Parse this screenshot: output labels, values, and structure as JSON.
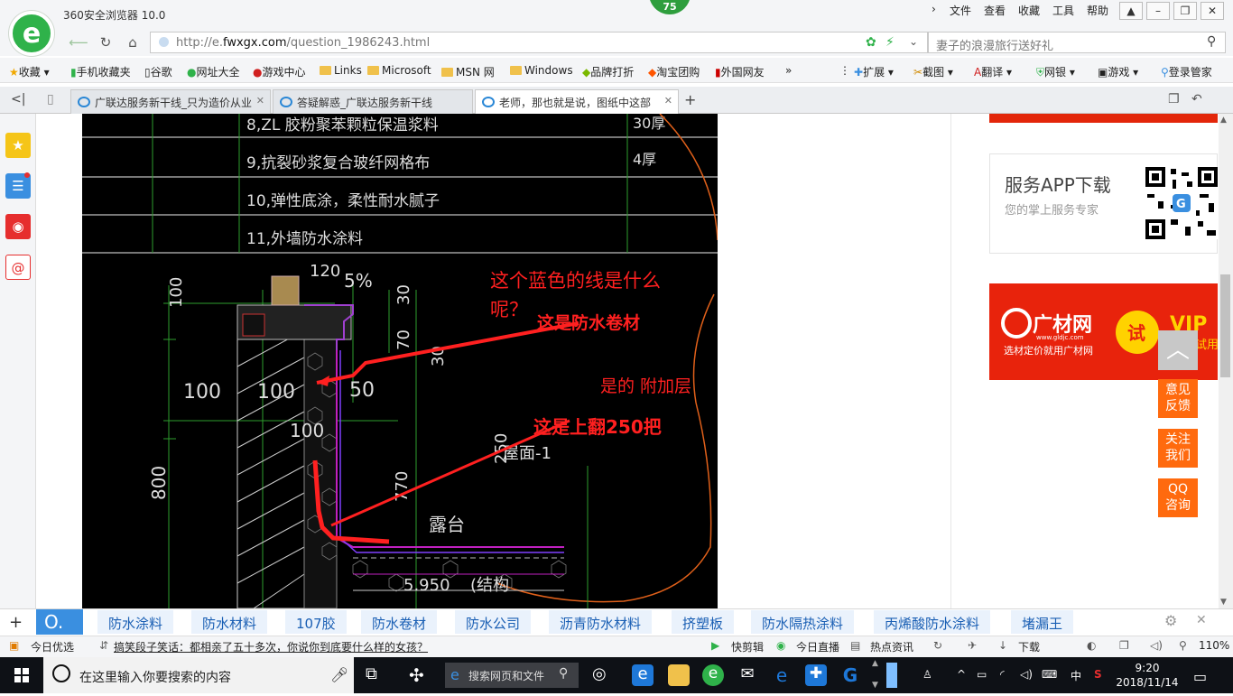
{
  "browser": {
    "title": "360安全浏览器 10.0",
    "badge": "75",
    "menu": [
      "文件",
      "查看",
      "收藏",
      "工具",
      "帮助"
    ]
  },
  "address": {
    "url_prefix": "http://e.",
    "url_domain": "fwxgx.com",
    "url_path": "/question_1986243.html",
    "search_placeholder": "妻子的浪漫旅行送好礼"
  },
  "favorites": [
    "收藏",
    "手机收藏夹",
    "谷歌",
    "网址大全",
    "游戏中心",
    "Links",
    "Microsoft",
    "MSN 网",
    "Windows",
    "品牌打折",
    "淘宝团购",
    "外国网友"
  ],
  "tools": [
    "扩展",
    "截图",
    "翻译",
    "网银",
    "游戏",
    "登录管家"
  ],
  "tabs": [
    {
      "label": "广联达服务新干线_只为造价从业"
    },
    {
      "label": "答疑解惑_广联达服务新干线"
    },
    {
      "label": "老师，那也就是说，图纸中这部"
    }
  ],
  "cad": {
    "table_rows": [
      "8,ZL 胶粉聚苯颗粒保温浆料",
      "9,抗裂砂浆复合玻纤网格布",
      "10,弹性底涂，柔性耐水腻子",
      "11,外墙防水涂料"
    ],
    "table_thick": [
      "30厚",
      "4厚"
    ],
    "dims": [
      "100",
      "100",
      "100",
      "50",
      "100",
      "800",
      "770",
      "70",
      "30",
      "120",
      "5%",
      "30",
      "250"
    ],
    "labels": [
      "屋面-1",
      "露台",
      "5.950",
      "(结构"
    ],
    "annotations": [
      "这个蓝色的线是什么",
      "呢？",
      "这是防水卷材",
      "是的  附加层",
      "这是上翻250把"
    ]
  },
  "right": {
    "app_title": "服务APP下载",
    "app_sub": "您的掌上服务专家",
    "ad_brand": "广材网",
    "ad_url": "www.gldjc.com",
    "ad_slogan": "选材定价就用广材网",
    "ad_try": "试",
    "ad_vip": "VIP",
    "ad_vip2": "试用",
    "btns": [
      "意见反馈",
      "关注我们",
      "QQ咨询"
    ]
  },
  "keywords": [
    "防水涂料",
    "防水材料",
    "107胶",
    "防水卷材",
    "防水公司",
    "沥青防水材料",
    "挤塑板",
    "防水隔热涂料",
    "丙烯酸防水涂料",
    "堵漏王"
  ],
  "status": {
    "left": "今日优选",
    "news": "搞笑段子笑话：都相亲了五十多次，你说你到底要什么样的女孩？",
    "items": [
      "快剪辑",
      "今日直播",
      "热点资讯",
      "下载",
      "110%"
    ]
  },
  "taskbar": {
    "search_placeholder": "在这里输入你要搜索的内容",
    "search2": "搜索网页和文件",
    "ime": "中",
    "time": "9:20",
    "date": "2018/11/14"
  }
}
